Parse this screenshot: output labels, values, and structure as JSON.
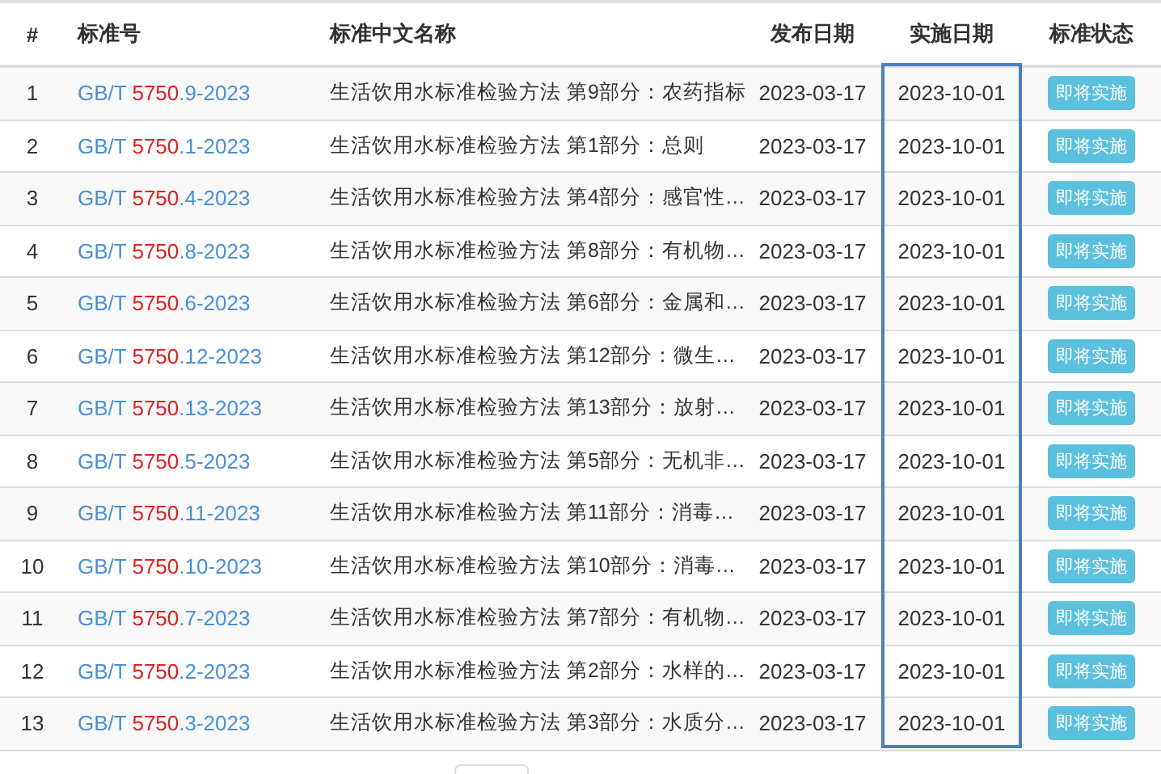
{
  "columns": [
    {
      "label": "#",
      "highlighted": false
    },
    {
      "label": "标准号",
      "highlighted": false
    },
    {
      "label": "标准中文名称",
      "highlighted": false
    },
    {
      "label": "发布日期",
      "highlighted": false
    },
    {
      "label": "实施日期",
      "highlighted": true
    },
    {
      "label": "标准状态",
      "highlighted": false
    }
  ],
  "rows": [
    {
      "index": "1",
      "code": {
        "prefix": "GB/T ",
        "highlight": "5750",
        "suffix": ".9-2023"
      },
      "name": "生活饮用水标准检验方法 第9部分：农药指标",
      "published": "2023-03-17",
      "effective": "2023-10-01",
      "status": "即将实施"
    },
    {
      "index": "2",
      "code": {
        "prefix": "GB/T ",
        "highlight": "5750",
        "suffix": ".1-2023"
      },
      "name": "生活饮用水标准检验方法 第1部分：总则",
      "published": "2023-03-17",
      "effective": "2023-10-01",
      "status": "即将实施"
    },
    {
      "index": "3",
      "code": {
        "prefix": "GB/T ",
        "highlight": "5750",
        "suffix": ".4-2023"
      },
      "name": "生活饮用水标准检验方法 第4部分：感官性…",
      "published": "2023-03-17",
      "effective": "2023-10-01",
      "status": "即将实施"
    },
    {
      "index": "4",
      "code": {
        "prefix": "GB/T ",
        "highlight": "5750",
        "suffix": ".8-2023"
      },
      "name": "生活饮用水标准检验方法 第8部分：有机物…",
      "published": "2023-03-17",
      "effective": "2023-10-01",
      "status": "即将实施"
    },
    {
      "index": "5",
      "code": {
        "prefix": "GB/T ",
        "highlight": "5750",
        "suffix": ".6-2023"
      },
      "name": "生活饮用水标准检验方法 第6部分：金属和…",
      "published": "2023-03-17",
      "effective": "2023-10-01",
      "status": "即将实施"
    },
    {
      "index": "6",
      "code": {
        "prefix": "GB/T ",
        "highlight": "5750",
        "suffix": ".12-2023"
      },
      "name": "生活饮用水标准检验方法 第12部分：微生…",
      "published": "2023-03-17",
      "effective": "2023-10-01",
      "status": "即将实施"
    },
    {
      "index": "7",
      "code": {
        "prefix": "GB/T ",
        "highlight": "5750",
        "suffix": ".13-2023"
      },
      "name": "生活饮用水标准检验方法 第13部分：放射…",
      "published": "2023-03-17",
      "effective": "2023-10-01",
      "status": "即将实施"
    },
    {
      "index": "8",
      "code": {
        "prefix": "GB/T ",
        "highlight": "5750",
        "suffix": ".5-2023"
      },
      "name": "生活饮用水标准检验方法 第5部分：无机非…",
      "published": "2023-03-17",
      "effective": "2023-10-01",
      "status": "即将实施"
    },
    {
      "index": "9",
      "code": {
        "prefix": "GB/T ",
        "highlight": "5750",
        "suffix": ".11-2023"
      },
      "name": "生活饮用水标准检验方法 第11部分：消毒…",
      "published": "2023-03-17",
      "effective": "2023-10-01",
      "status": "即将实施"
    },
    {
      "index": "10",
      "code": {
        "prefix": "GB/T ",
        "highlight": "5750",
        "suffix": ".10-2023"
      },
      "name": "生活饮用水标准检验方法 第10部分：消毒…",
      "published": "2023-03-17",
      "effective": "2023-10-01",
      "status": "即将实施"
    },
    {
      "index": "11",
      "code": {
        "prefix": "GB/T ",
        "highlight": "5750",
        "suffix": ".7-2023"
      },
      "name": "生活饮用水标准检验方法 第7部分：有机物…",
      "published": "2023-03-17",
      "effective": "2023-10-01",
      "status": "即将实施"
    },
    {
      "index": "12",
      "code": {
        "prefix": "GB/T ",
        "highlight": "5750",
        "suffix": ".2-2023"
      },
      "name": "生活饮用水标准检验方法 第2部分：水样的…",
      "published": "2023-03-17",
      "effective": "2023-10-01",
      "status": "即将实施"
    },
    {
      "index": "13",
      "code": {
        "prefix": "GB/T ",
        "highlight": "5750",
        "suffix": ".3-2023"
      },
      "name": "生活饮用水标准检验方法 第3部分：水质分…",
      "published": "2023-03-17",
      "effective": "2023-10-01",
      "status": "即将实施"
    }
  ]
}
